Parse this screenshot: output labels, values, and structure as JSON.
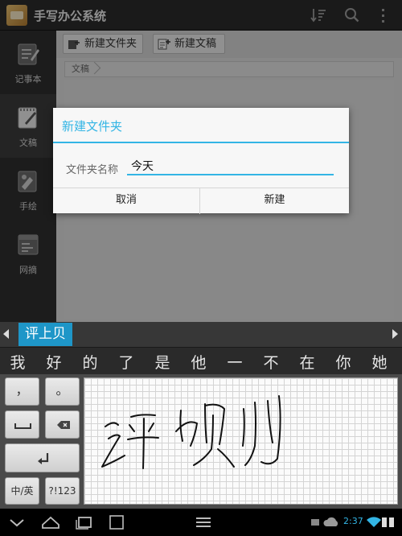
{
  "app": {
    "title": "手写办公系统"
  },
  "sidebar": {
    "items": [
      {
        "label": "记事本",
        "icon": "notepad-icon"
      },
      {
        "label": "文稿",
        "icon": "document-icon"
      },
      {
        "label": "手绘",
        "icon": "drawing-icon"
      },
      {
        "label": "网摘",
        "icon": "web-clip-icon"
      }
    ],
    "active_index": 1
  },
  "toolbar": {
    "new_folder_label": "新建文件夹",
    "new_doc_label": "新建文稿"
  },
  "breadcrumb": {
    "current": "文稿"
  },
  "dialog": {
    "title": "新建文件夹",
    "field_label": "文件夹名称",
    "field_value": "今天",
    "cancel_label": "取消",
    "create_label": "新建"
  },
  "ime": {
    "composition": "评上贝",
    "candidates": [
      "我",
      "好",
      "的",
      "了",
      "是",
      "他",
      "一",
      "不",
      "在",
      "你",
      "她"
    ]
  },
  "keyboard": {
    "comma": "，",
    "period": "。",
    "lang_label": "中/英",
    "symbols_label": "?!123"
  },
  "status": {
    "time": "2:37"
  },
  "colors": {
    "accent": "#33b5e5",
    "ime_highlight": "#1e96c8"
  }
}
